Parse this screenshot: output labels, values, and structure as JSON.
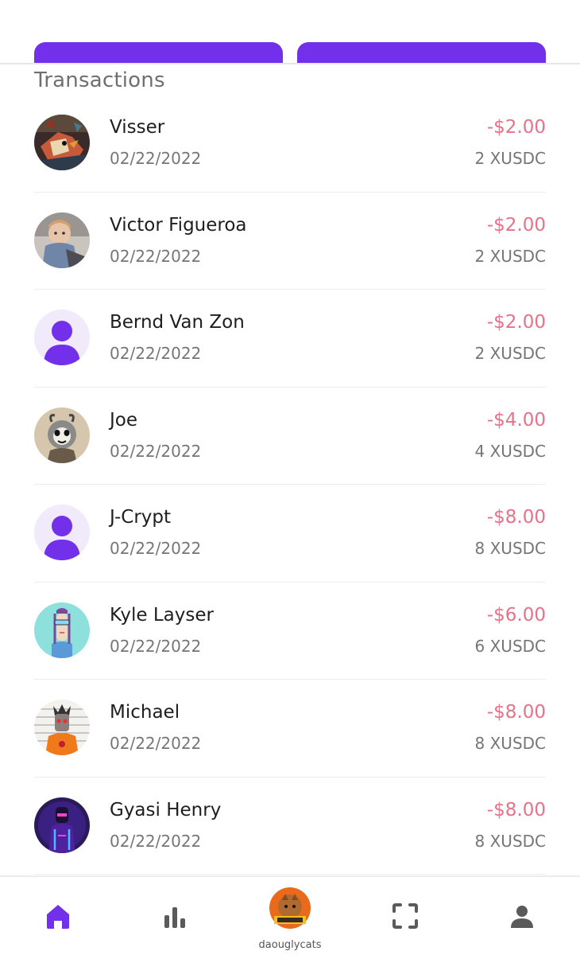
{
  "section_title": "Transactions",
  "accent_color": "#7330ea",
  "negative_color": "#e6728b",
  "transactions": [
    {
      "name": "Visser",
      "date": "02/22/2022",
      "amount": "-$2.00",
      "token": "2 XUSDC",
      "avatar": "nft-bird-icon"
    },
    {
      "name": "Victor Figueroa",
      "date": "02/22/2022",
      "amount": "-$2.00",
      "token": "2 XUSDC",
      "avatar": "photo-baby-icon"
    },
    {
      "name": "Bernd Van Zon",
      "date": "02/22/2022",
      "amount": "-$2.00",
      "token": "2 XUSDC",
      "avatar": "default-user-icon"
    },
    {
      "name": "Joe",
      "date": "02/22/2022",
      "amount": "-$4.00",
      "token": "4 XUSDC",
      "avatar": "nft-ape-icon"
    },
    {
      "name": "J-Crypt",
      "date": "02/22/2022",
      "amount": "-$8.00",
      "token": "8 XUSDC",
      "avatar": "default-user-icon"
    },
    {
      "name": "Kyle Layser",
      "date": "02/22/2022",
      "amount": "-$6.00",
      "token": "6 XUSDC",
      "avatar": "nft-character-icon"
    },
    {
      "name": "Michael",
      "date": "02/22/2022",
      "amount": "-$8.00",
      "token": "8 XUSDC",
      "avatar": "nft-punk-icon"
    },
    {
      "name": "Gyasi Henry",
      "date": "02/22/2022",
      "amount": "-$8.00",
      "token": "8 XUSDC",
      "avatar": "nft-neon-icon"
    }
  ],
  "bottom_nav": {
    "items": [
      {
        "icon": "home-icon",
        "active": true
      },
      {
        "icon": "stats-icon",
        "active": false
      },
      {
        "icon": "community-avatar-icon",
        "label": "daouglycats"
      },
      {
        "icon": "scan-icon",
        "active": false
      },
      {
        "icon": "profile-icon",
        "active": false
      }
    ]
  }
}
